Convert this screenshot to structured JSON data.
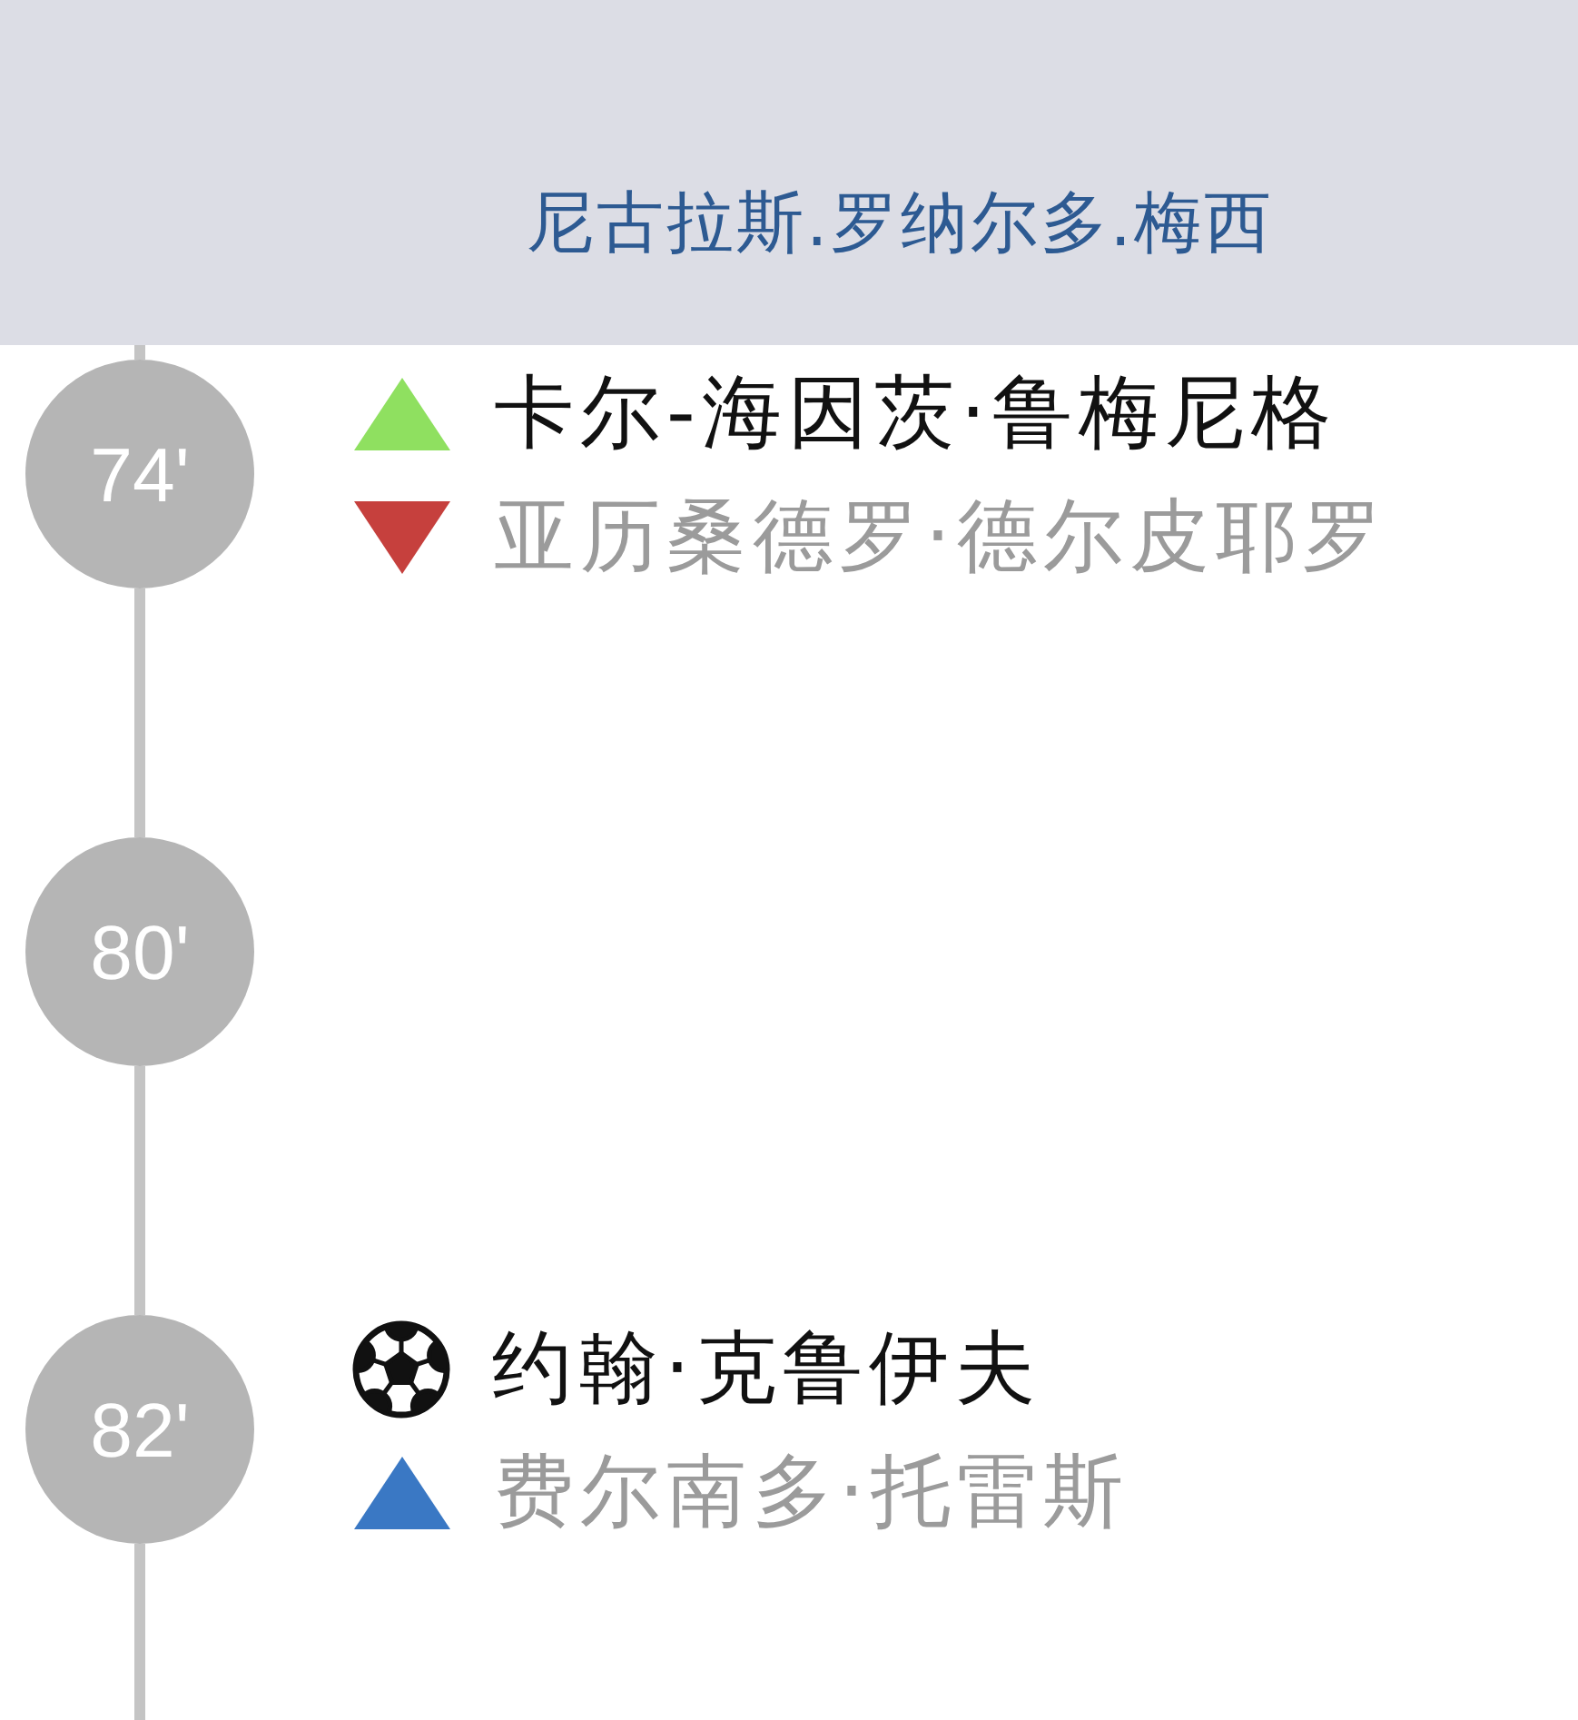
{
  "header": {
    "player_name": "尼古拉斯.罗纳尔多.梅西"
  },
  "timeline": [
    {
      "minute": "74'",
      "events": [
        {
          "kind": "sub_in",
          "player": "卡尔-海因茨·鲁梅尼格"
        },
        {
          "kind": "sub_out",
          "player": "亚历桑德罗·德尔皮耶罗"
        }
      ]
    },
    {
      "minute": "80'"
    },
    {
      "minute": "82'",
      "events": [
        {
          "kind": "goal",
          "player": "约翰·克鲁伊夫"
        },
        {
          "kind": "assist",
          "player": "费尔南多·托雷斯"
        }
      ]
    }
  ]
}
